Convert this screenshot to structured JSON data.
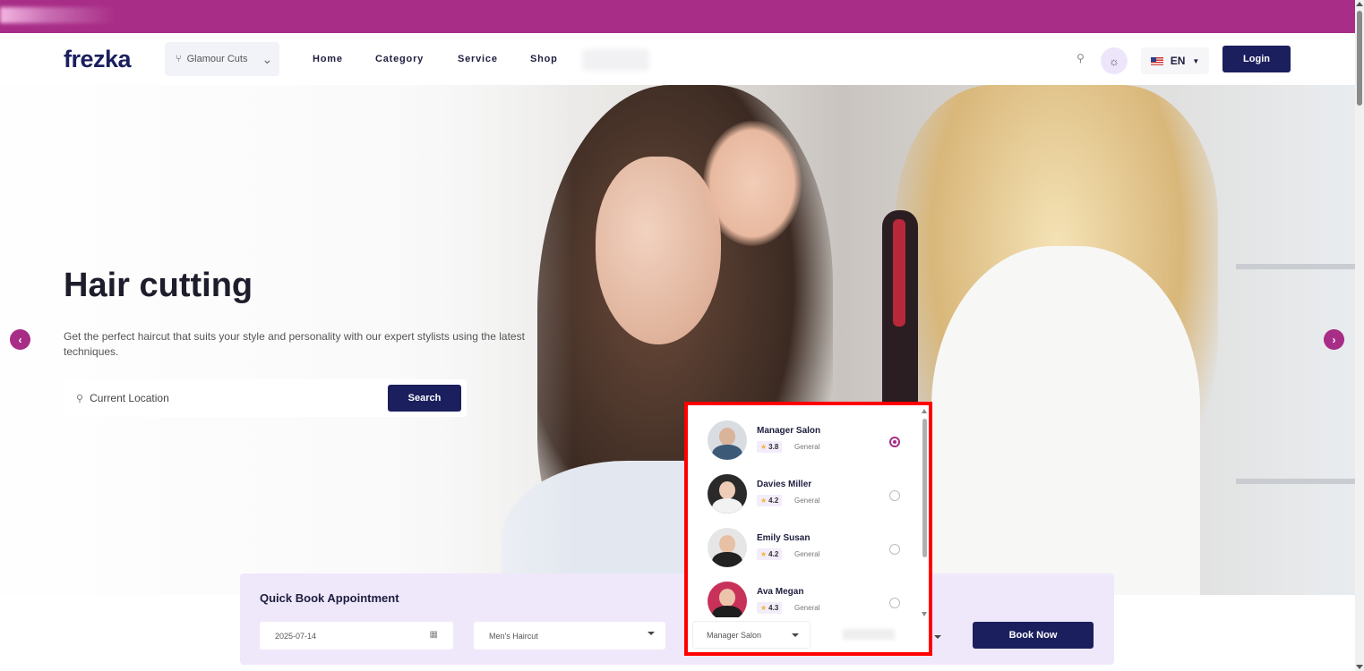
{
  "navbar": {
    "logo": "frezka",
    "branch": {
      "icon": "branch-icon",
      "label": "Glamour Cuts"
    },
    "links": [
      "Home",
      "Category",
      "Service",
      "Shop"
    ],
    "language": "EN",
    "login_label": "Login"
  },
  "hero": {
    "title": "Hair cutting",
    "description": "Get the perfect haircut that suits your style and personality with our expert stylists using the latest techniques.",
    "location_placeholder": "Current Location",
    "search_label": "Search"
  },
  "quick_book": {
    "title": "Quick Book Appointment",
    "date": "2025-07-14",
    "service": "Men's Haircut",
    "staff_selected": "Manager Salon",
    "book_label": "Book Now"
  },
  "staff_dropdown": {
    "items": [
      {
        "name": "Manager Salon",
        "rating": "3.8",
        "role": "General",
        "selected": true
      },
      {
        "name": "Davies Miller",
        "rating": "4.2",
        "role": "General",
        "selected": false
      },
      {
        "name": "Emily Susan",
        "rating": "4.2",
        "role": "General",
        "selected": false
      },
      {
        "name": "Ava Megan",
        "rating": "4.3",
        "role": "General",
        "selected": false
      }
    ]
  },
  "colors": {
    "brand": "#a82d87",
    "primary_navy": "#1b1f5e",
    "highlight": "#ff0000",
    "quick_book_bg": "#efe8fb"
  }
}
